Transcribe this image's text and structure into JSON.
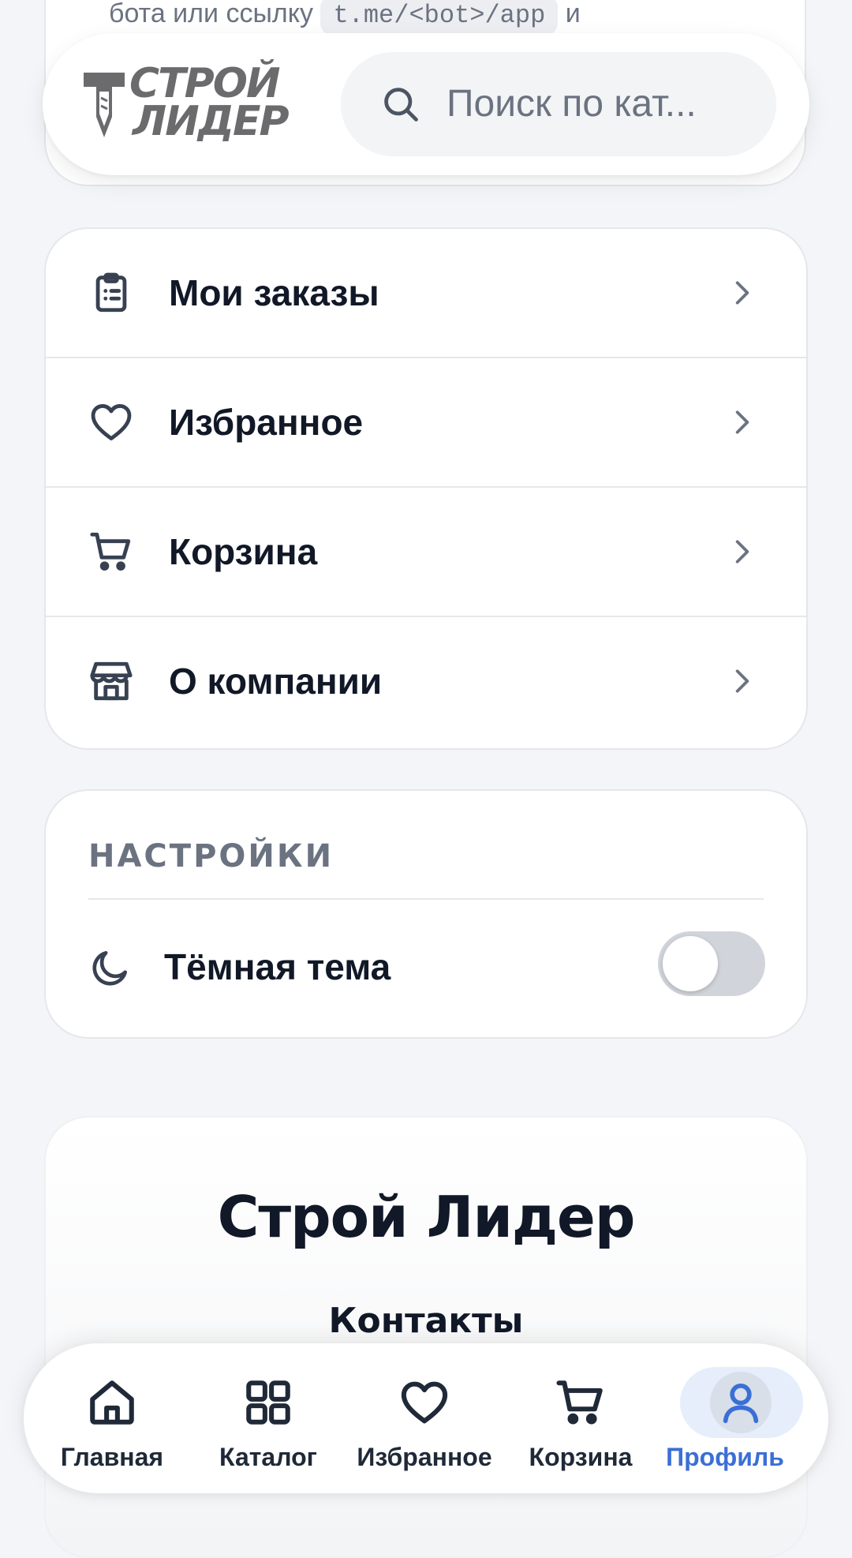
{
  "top_card": {
    "partial_text": "бота или ссылку",
    "partial_code": "t.me/<bot>/app",
    "partial_tail": "и"
  },
  "header": {
    "logo": {
      "line1": "СТРОЙ",
      "line2": "ЛИДЕР"
    },
    "search": {
      "placeholder": "Поиск по кат...",
      "icon": "search-icon"
    }
  },
  "menu": {
    "items": [
      {
        "label": "Мои заказы",
        "icon": "clipboard-list-icon"
      },
      {
        "label": "Избранное",
        "icon": "heart-icon"
      },
      {
        "label": "Корзина",
        "icon": "cart-icon"
      },
      {
        "label": "О компании",
        "icon": "store-icon"
      }
    ]
  },
  "settings": {
    "title": "НАСТРОЙКИ",
    "dark_theme": {
      "label": "Тёмная тема",
      "enabled": false,
      "icon": "moon-icon"
    }
  },
  "footer": {
    "brand": "Строй Лидер",
    "contacts_title": "Контакты"
  },
  "bottom_nav": {
    "items": [
      {
        "label": "Главная",
        "icon": "home-icon",
        "active": false
      },
      {
        "label": "Каталог",
        "icon": "grid-icon",
        "active": false
      },
      {
        "label": "Избранное",
        "icon": "heart-icon",
        "active": false
      },
      {
        "label": "Корзина",
        "icon": "cart-icon",
        "active": false
      },
      {
        "label": "Профиль",
        "icon": "user-icon",
        "active": true
      }
    ]
  },
  "colors": {
    "accent": "#3b6fd6",
    "text": "#111827",
    "muted": "#6b7280",
    "background": "#f3f5f8"
  }
}
